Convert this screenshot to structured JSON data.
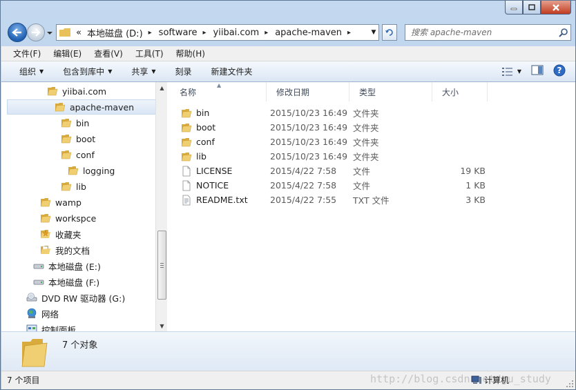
{
  "window": {
    "controls": {
      "minimize": "minimize",
      "maximize": "maximize",
      "close": "close"
    }
  },
  "address": {
    "overflow": "«",
    "crumbs": [
      "本地磁盘 (D:)",
      "software",
      "yiibai.com",
      "apache-maven"
    ]
  },
  "search": {
    "placeholder": "搜索 apache-maven"
  },
  "menu": [
    "文件(F)",
    "编辑(E)",
    "查看(V)",
    "工具(T)",
    "帮助(H)"
  ],
  "toolbar": {
    "organize": "组织",
    "include_in_library": "包含到库中",
    "share": "共享",
    "burn": "刻录",
    "new_folder": "新建文件夹"
  },
  "tree": [
    {
      "label": "yiibai.com",
      "icon": "folder-icon",
      "depth": 2
    },
    {
      "label": "apache-maven",
      "icon": "folder-icon",
      "depth": 3,
      "selected": true
    },
    {
      "label": "bin",
      "icon": "folder-icon",
      "depth": 4
    },
    {
      "label": "boot",
      "icon": "folder-icon",
      "depth": 4
    },
    {
      "label": "conf",
      "icon": "folder-icon",
      "depth": 4
    },
    {
      "label": "logging",
      "icon": "folder-icon",
      "depth": 5
    },
    {
      "label": "lib",
      "icon": "folder-icon",
      "depth": 4
    },
    {
      "label": "wamp",
      "icon": "folder-icon",
      "depth": 1
    },
    {
      "label": "workspce",
      "icon": "folder-icon",
      "depth": 1
    },
    {
      "label": "收藏夹",
      "icon": "favorites-folder-icon",
      "depth": 1
    },
    {
      "label": "我的文档",
      "icon": "documents-folder-icon",
      "depth": 1
    },
    {
      "label": "本地磁盘 (E:)",
      "icon": "drive-icon",
      "depth": 0
    },
    {
      "label": "本地磁盘 (F:)",
      "icon": "drive-icon",
      "depth": 0
    },
    {
      "label": "DVD RW 驱动器 (G:)",
      "icon": "dvd-drive-icon",
      "depth": -1
    },
    {
      "label": "网络",
      "icon": "network-icon",
      "depth": -1
    },
    {
      "label": "控制面板",
      "icon": "control-panel-icon",
      "depth": -1
    }
  ],
  "columns": {
    "name": "名称",
    "date": "修改日期",
    "type": "类型",
    "size": "大小"
  },
  "files": [
    {
      "name": "bin",
      "date": "2015/10/23 16:49",
      "type": "文件夹",
      "size": "",
      "icon": "folder-icon"
    },
    {
      "name": "boot",
      "date": "2015/10/23 16:49",
      "type": "文件夹",
      "size": "",
      "icon": "folder-icon"
    },
    {
      "name": "conf",
      "date": "2015/10/23 16:49",
      "type": "文件夹",
      "size": "",
      "icon": "folder-icon"
    },
    {
      "name": "lib",
      "date": "2015/10/23 16:49",
      "type": "文件夹",
      "size": "",
      "icon": "folder-icon"
    },
    {
      "name": "LICENSE",
      "date": "2015/4/22 7:58",
      "type": "文件",
      "size": "19 KB",
      "icon": "file-icon"
    },
    {
      "name": "NOTICE",
      "date": "2015/4/22 7:58",
      "type": "文件",
      "size": "1 KB",
      "icon": "file-icon"
    },
    {
      "name": "README.txt",
      "date": "2015/4/22 7:55",
      "type": "TXT 文件",
      "size": "3 KB",
      "icon": "text-file-icon"
    }
  ],
  "details": {
    "summary": "7 个对象"
  },
  "status": {
    "items": "7 个项目",
    "location": "计算机",
    "watermark": "http://blog.csdn.net/gu_study"
  },
  "colors": {
    "folder": "#e8c15a",
    "selection": "#d9e6f5",
    "chrome": "#b9d1ea"
  }
}
